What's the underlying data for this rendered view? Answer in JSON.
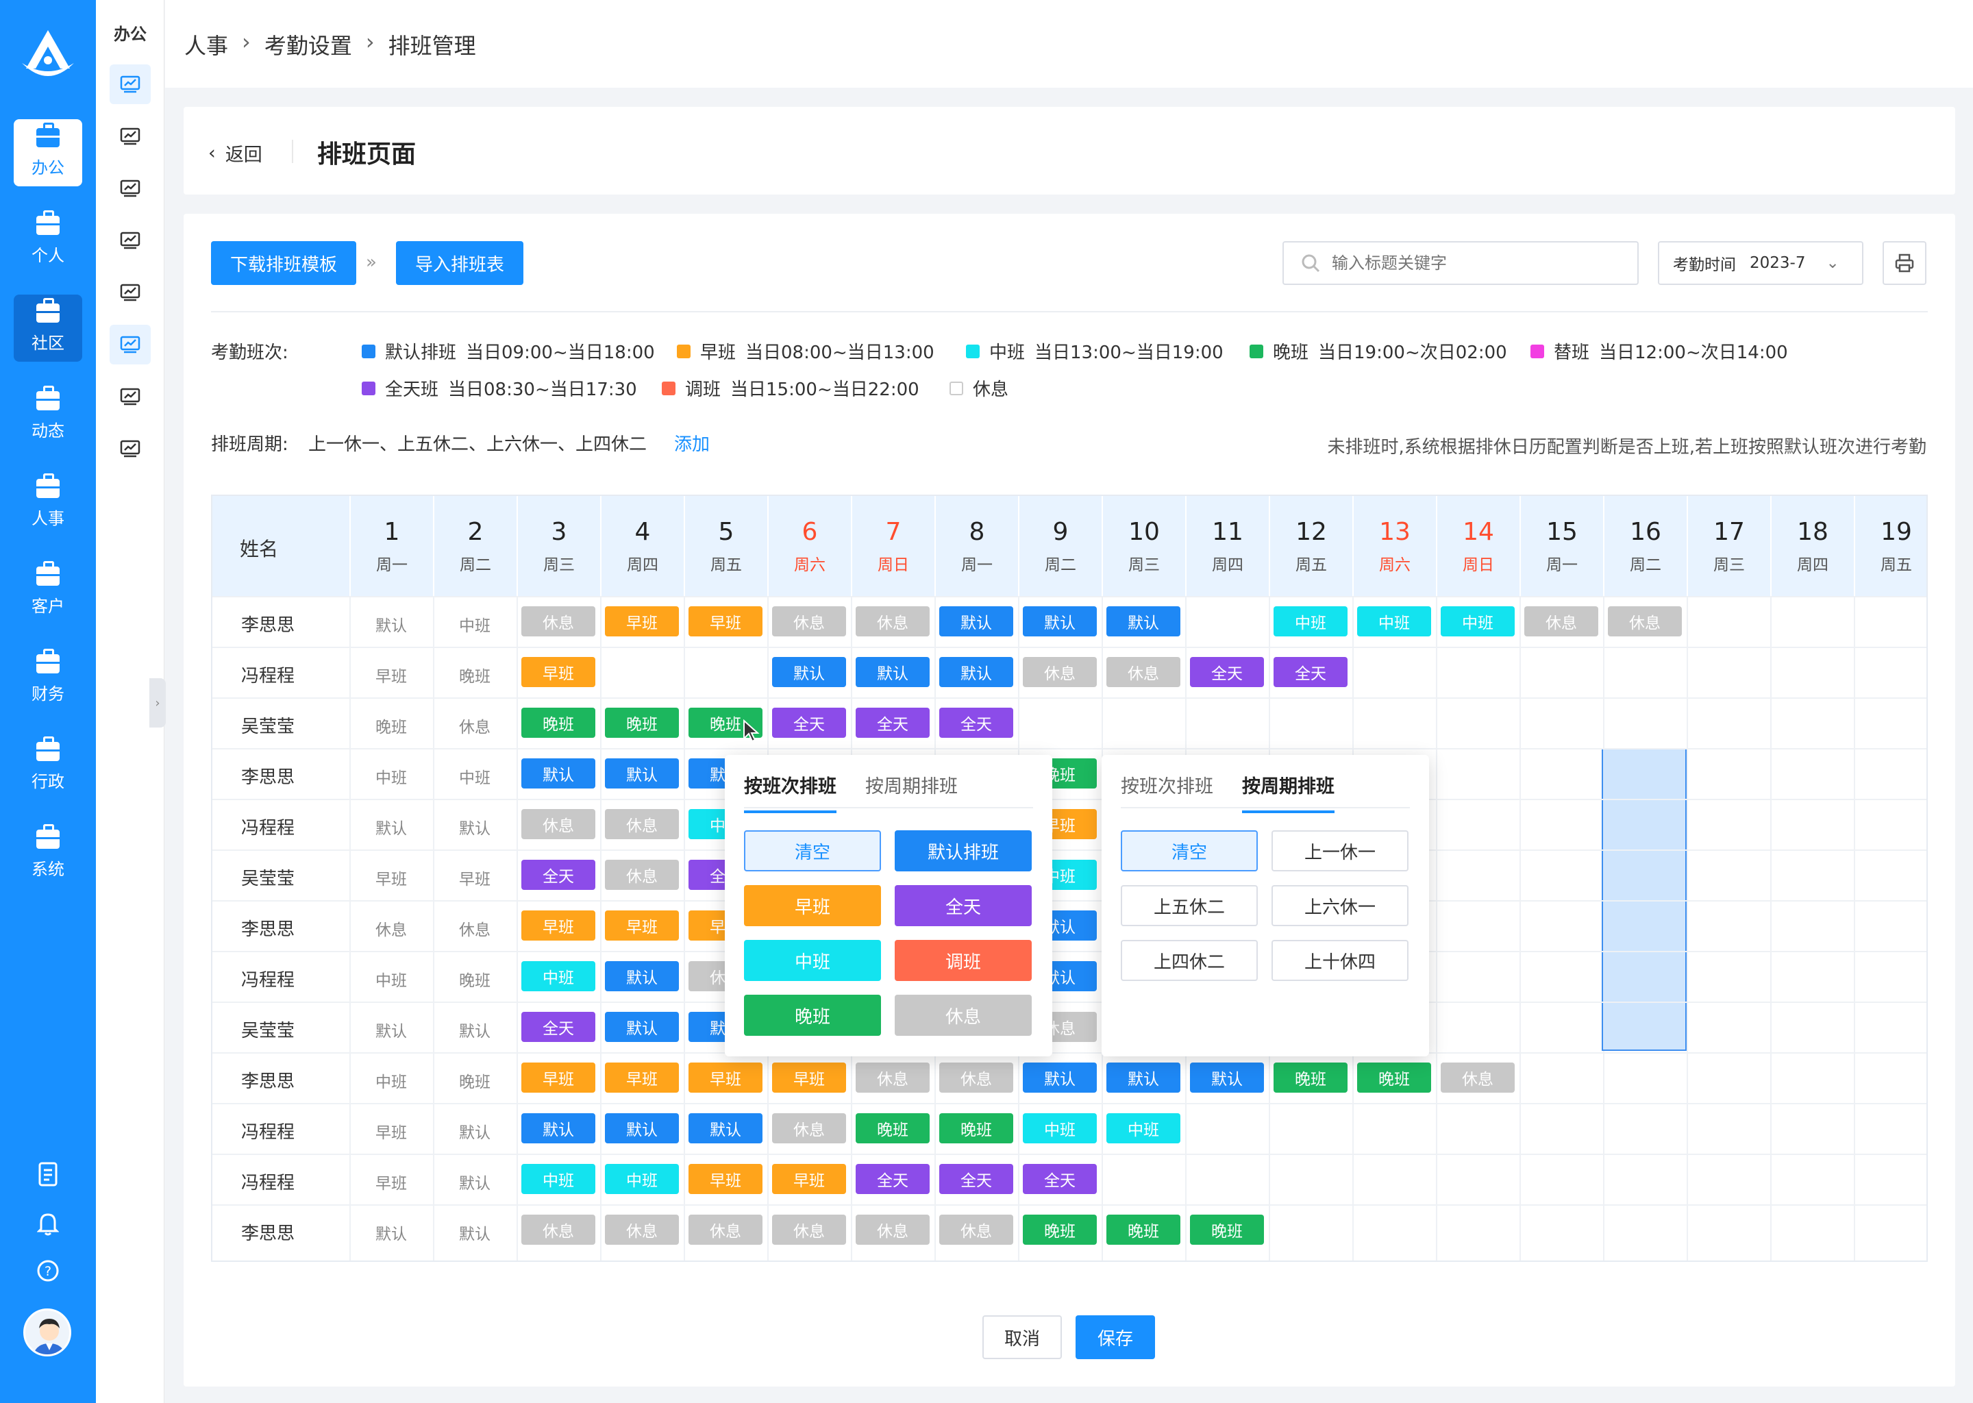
{
  "rail": {
    "items": [
      {
        "label": "办公",
        "active": true
      },
      {
        "label": "个人"
      },
      {
        "label": "社区",
        "hover": true
      },
      {
        "label": "动态"
      },
      {
        "label": "人事"
      },
      {
        "label": "客户"
      },
      {
        "label": "财务"
      },
      {
        "label": "行政"
      },
      {
        "label": "系统"
      }
    ]
  },
  "sub": {
    "title": "办公"
  },
  "breadcrumb": [
    "人事",
    "考勤设置",
    "排班管理"
  ],
  "header": {
    "back": "返回",
    "title": "排班页面"
  },
  "toolbar": {
    "download": "下载排班模板",
    "import": "导入排班表",
    "search_placeholder": "输入标题关键字",
    "date_label": "考勤时间",
    "date_value": "2023-7"
  },
  "legend": {
    "label": "考勤班次:",
    "items": [
      {
        "name": "默认排班",
        "time": "当日09:00~当日18:00",
        "color": "#1e88f5"
      },
      {
        "name": "早班",
        "time": "当日08:00~当日13:00",
        "color": "#ffa41b"
      },
      {
        "name": "中班",
        "time": "当日13:00~当日19:00",
        "color": "#13e3ef"
      },
      {
        "name": "晚班",
        "time": "当日19:00~次日02:00",
        "color": "#1cb75e"
      },
      {
        "name": "替班",
        "time": "当日12:00~次日14:00",
        "color": "#f23fe2"
      },
      {
        "name": "全天班",
        "time": "当日08:30~当日17:30",
        "color": "#8c4ce9"
      },
      {
        "name": "调班",
        "time": "当日15:00~当日22:00",
        "color": "#ff6a4d"
      },
      {
        "name": "休息",
        "time": "",
        "color": "#ffffff"
      }
    ]
  },
  "cycle": {
    "label": "排班周期:",
    "value": "上一休一、上五休二、上六休一、上四休二",
    "add": "添加"
  },
  "note": "未排班时,系统根据排休日历配置判断是否上班,若上班按照默认班次进行考勤",
  "grid": {
    "name_header": "姓名",
    "days": [
      {
        "d": "1",
        "w": "周一"
      },
      {
        "d": "2",
        "w": "周二"
      },
      {
        "d": "3",
        "w": "周三"
      },
      {
        "d": "4",
        "w": "周四"
      },
      {
        "d": "5",
        "w": "周五"
      },
      {
        "d": "6",
        "w": "周六",
        "red": true
      },
      {
        "d": "7",
        "w": "周日",
        "red": true
      },
      {
        "d": "8",
        "w": "周一"
      },
      {
        "d": "9",
        "w": "周二"
      },
      {
        "d": "10",
        "w": "周三"
      },
      {
        "d": "11",
        "w": "周四"
      },
      {
        "d": "12",
        "w": "周五"
      },
      {
        "d": "13",
        "w": "周六",
        "red": true
      },
      {
        "d": "14",
        "w": "周日",
        "red": true
      },
      {
        "d": "15",
        "w": "周一"
      },
      {
        "d": "16",
        "w": "周二"
      },
      {
        "d": "17",
        "w": "周三"
      },
      {
        "d": "18",
        "w": "周四"
      },
      {
        "d": "19",
        "w": "周五"
      }
    ],
    "rows": [
      {
        "name": "李思思",
        "cells": [
          "默认",
          "中班",
          "休息",
          "早班",
          "早班",
          "休息",
          "休息",
          "默认",
          "默认",
          "默认",
          "",
          "中班",
          "中班",
          "中班",
          "休息",
          "休息",
          "",
          "",
          ""
        ]
      },
      {
        "name": "冯程程",
        "cells": [
          "早班",
          "晚班",
          "早班",
          "",
          "",
          "默认",
          "默认",
          "默认",
          "休息",
          "休息",
          "全天",
          "全天",
          "",
          "",
          "",
          "",
          "",
          "",
          ""
        ]
      },
      {
        "name": "吴莹莹",
        "cells": [
          "晚班",
          "休息",
          "晚班",
          "晚班",
          "晚班",
          "全天",
          "全天",
          "全天",
          "",
          "",
          "",
          "",
          "",
          "",
          "",
          "",
          "",
          "",
          ""
        ]
      },
      {
        "name": "李思思",
        "cells": [
          "中班",
          "中班",
          "默认",
          "默认",
          "默认",
          "",
          "",
          "",
          "晚班",
          "",
          "",
          "",
          "",
          "",
          "",
          "",
          "",
          "",
          ""
        ]
      },
      {
        "name": "冯程程",
        "cells": [
          "默认",
          "默认",
          "休息",
          "休息",
          "中班",
          "",
          "",
          "",
          "早班",
          "",
          "",
          "",
          "",
          "",
          "",
          "",
          "",
          "",
          ""
        ]
      },
      {
        "name": "吴莹莹",
        "cells": [
          "早班",
          "早班",
          "全天",
          "休息",
          "全天",
          "",
          "",
          "",
          "中班",
          "",
          "",
          "",
          "",
          "",
          "",
          "",
          "",
          "",
          ""
        ]
      },
      {
        "name": "李思思",
        "cells": [
          "休息",
          "休息",
          "早班",
          "早班",
          "早班",
          "",
          "",
          "",
          "默认",
          "",
          "",
          "",
          "",
          "",
          "",
          "",
          "",
          "",
          ""
        ]
      },
      {
        "name": "冯程程",
        "cells": [
          "中班",
          "晚班",
          "中班",
          "默认",
          "休息",
          "",
          "",
          "",
          "默认",
          "",
          "",
          "",
          "",
          "",
          "",
          "",
          "",
          "",
          ""
        ]
      },
      {
        "name": "吴莹莹",
        "cells": [
          "默认",
          "默认",
          "全天",
          "默认",
          "默认",
          "",
          "",
          "",
          "休息",
          "",
          "",
          "",
          "",
          "",
          "",
          "",
          "",
          "",
          ""
        ]
      },
      {
        "name": "李思思",
        "cells": [
          "中班",
          "晚班",
          "早班",
          "早班",
          "早班",
          "早班",
          "休息",
          "休息",
          "默认",
          "默认",
          "默认",
          "晚班",
          "晚班",
          "休息",
          "",
          "",
          "",
          "",
          ""
        ]
      },
      {
        "name": "冯程程",
        "cells": [
          "早班",
          "默认",
          "默认",
          "默认",
          "默认",
          "休息",
          "晚班",
          "晚班",
          "中班",
          "中班",
          "",
          "",
          "",
          "",
          "",
          "",
          "",
          "",
          ""
        ]
      },
      {
        "name": "冯程程",
        "cells": [
          "早班",
          "默认",
          "中班",
          "中班",
          "早班",
          "早班",
          "全天",
          "全天",
          "全天",
          "",
          "",
          "",
          "",
          "",
          "",
          "",
          "",
          "",
          ""
        ]
      },
      {
        "name": "李思思",
        "cells": [
          "默认",
          "默认",
          "休息",
          "休息",
          "休息",
          "休息",
          "休息",
          "休息",
          "晚班",
          "晚班",
          "晚班",
          "",
          "",
          "",
          "",
          "",
          "",
          "",
          ""
        ]
      }
    ]
  },
  "chip_colors": {
    "默认": "#1e88f5",
    "早班": "#ffa41b",
    "中班": "#13e3ef",
    "晚班": "#1cb75e",
    "全天": "#8c4ce9",
    "休息": "#c8c8c8",
    "调班": "#ff6a4d",
    "替班": "#f23fe2"
  },
  "popup1": {
    "tabs": [
      "按班次排班",
      "按周期排班"
    ],
    "active_tab": 0,
    "buttons": [
      {
        "label": "清空",
        "style": "clear"
      },
      {
        "label": "默认排班",
        "color": "#1e88f5"
      },
      {
        "label": "早班",
        "color": "#ffa41b"
      },
      {
        "label": "全天",
        "color": "#8c4ce9"
      },
      {
        "label": "中班",
        "color": "#13e3ef"
      },
      {
        "label": "调班",
        "color": "#ff6a4d"
      },
      {
        "label": "晚班",
        "color": "#1cb75e"
      },
      {
        "label": "休息",
        "color": "#c8c8c8"
      }
    ]
  },
  "popup2": {
    "tabs": [
      "按班次排班",
      "按周期排班"
    ],
    "active_tab": 1,
    "buttons": [
      {
        "label": "清空",
        "style": "clear"
      },
      {
        "label": "上一休一"
      },
      {
        "label": "上五休二"
      },
      {
        "label": "上六休一"
      },
      {
        "label": "上四休二"
      },
      {
        "label": "上十休四"
      }
    ]
  },
  "footer": {
    "cancel": "取消",
    "save": "保存"
  }
}
